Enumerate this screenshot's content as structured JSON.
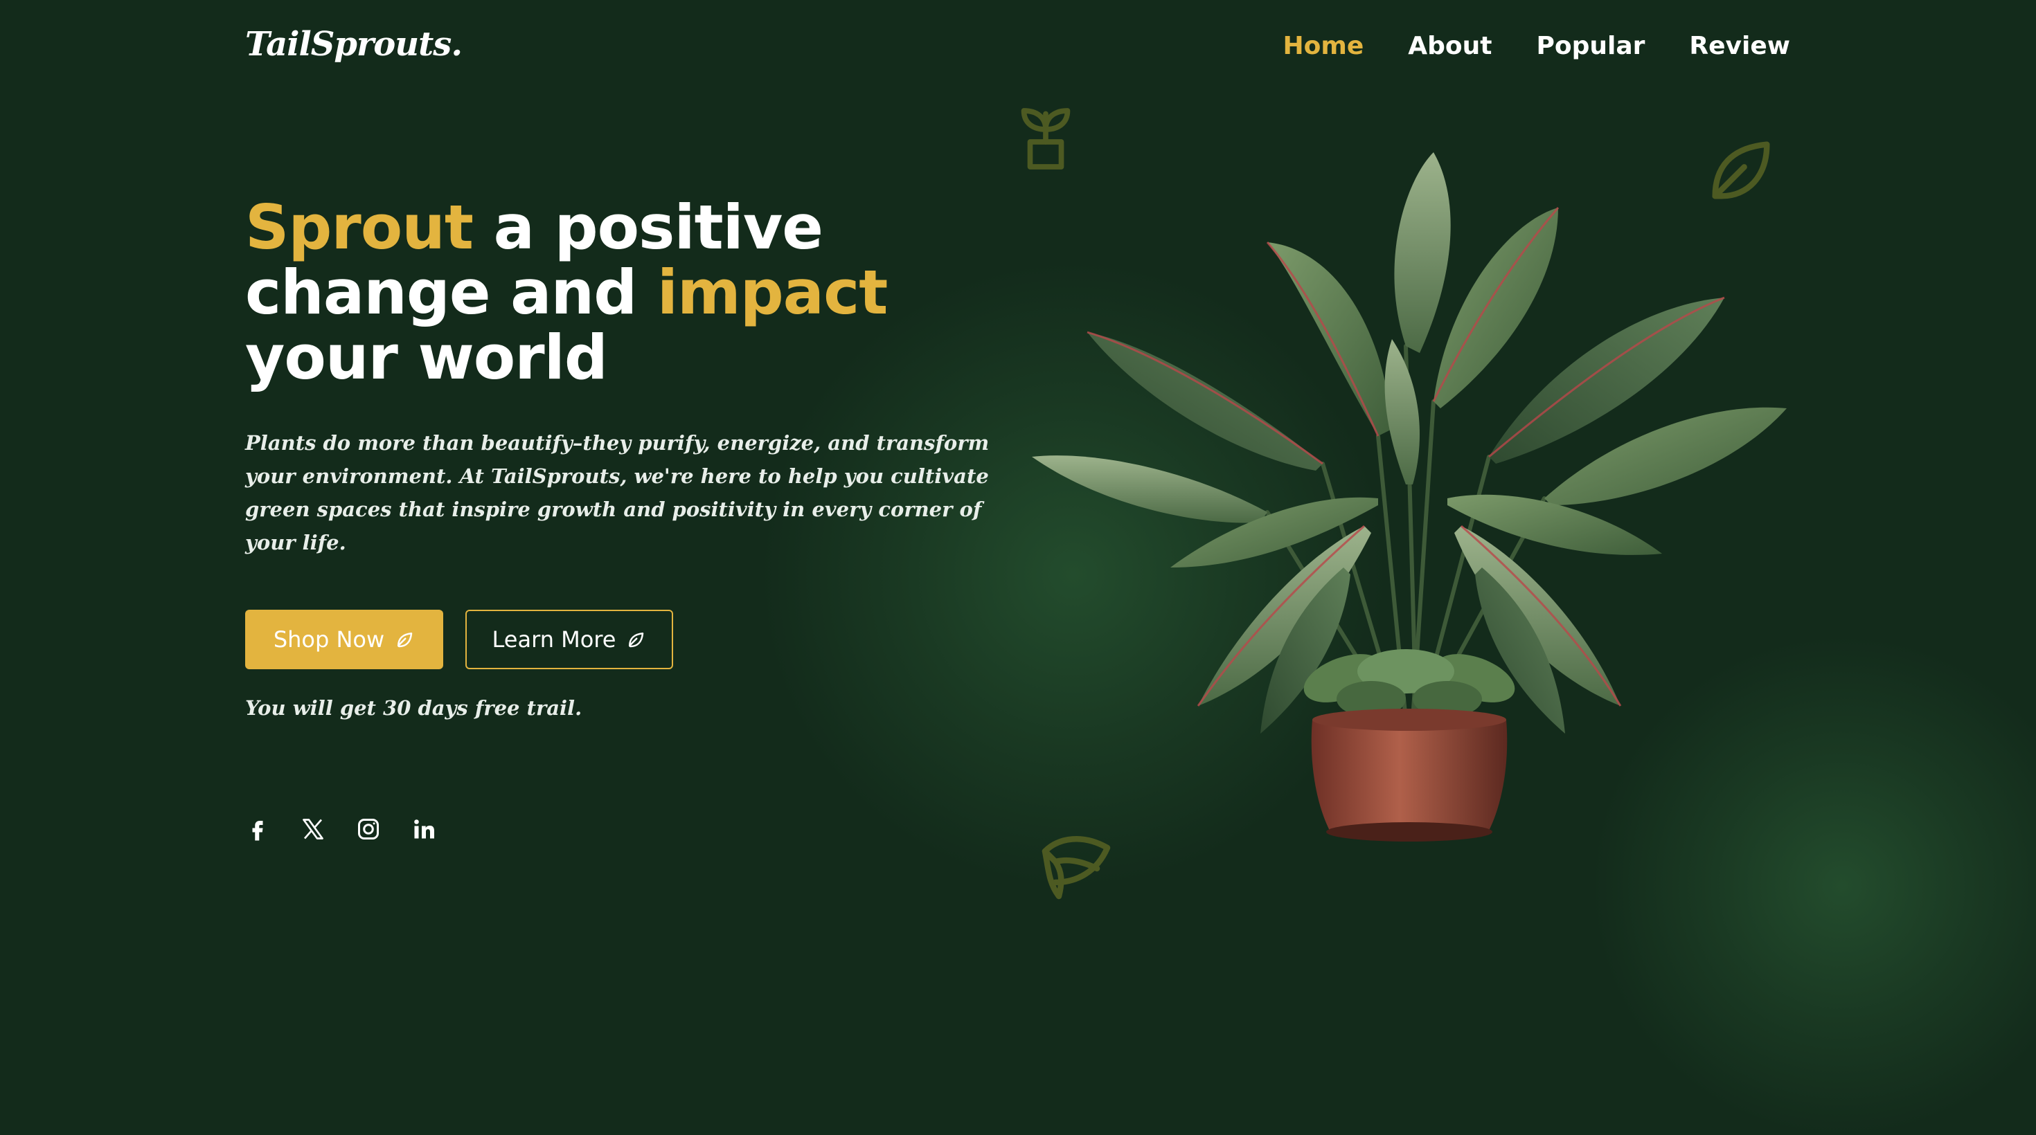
{
  "brand": {
    "name": "TailSprouts."
  },
  "nav": {
    "items": [
      {
        "label": "Home",
        "active": true
      },
      {
        "label": "About",
        "active": false
      },
      {
        "label": "Popular",
        "active": false
      },
      {
        "label": "Review",
        "active": false
      }
    ]
  },
  "hero": {
    "headline": {
      "part1": "Sprout",
      "part2": " a positive",
      "part3": "change and ",
      "part4": "impact",
      "part5": "your world"
    },
    "description": "Plants do more than beautify–they purify, energize, and transform your environment. At TailSprouts, we're here to help you cultivate green spaces that inspire growth and positivity in every corner of your life.",
    "primary_button": {
      "label": "Shop Now",
      "icon": "leaf-icon"
    },
    "secondary_button": {
      "label": "Learn More",
      "icon": "leaf-icon"
    },
    "trial_note": "You will get 30 days free trail."
  },
  "social": [
    "facebook-icon",
    "x-icon",
    "instagram-icon",
    "linkedin-icon"
  ],
  "colors": {
    "background": "#132b1b",
    "accent": "#e3b43f",
    "text": "#ffffff",
    "deco": "#4d5a22"
  }
}
